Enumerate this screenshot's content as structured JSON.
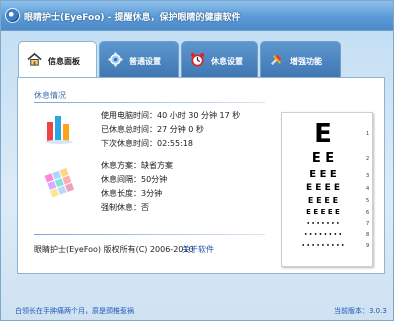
{
  "window": {
    "title": "眼睛护士(EyeFoo) - 提醒休息，保护眼睛的健康软件"
  },
  "tabs": [
    {
      "label": "信息面板",
      "icon": "home-icon",
      "active": true
    },
    {
      "label": "普通设置",
      "icon": "settings-gear-icon",
      "active": false
    },
    {
      "label": "休息设置",
      "icon": "alarm-clock-icon",
      "active": false
    },
    {
      "label": "增强功能",
      "icon": "tools-icon",
      "active": false
    }
  ],
  "info": {
    "section_title": "休息情况",
    "usage_icon": "bar-chart-icon",
    "usage": [
      {
        "label": "使用电脑时间：",
        "value": "40 小时 30 分钟 17 秒"
      },
      {
        "label": "已休息总时间：",
        "value": "27 分钟 0 秒"
      },
      {
        "label": "下次休息时间：",
        "value": "02:55:18"
      }
    ],
    "plan_icon": "color-palette-icon",
    "plan": [
      {
        "label": "休息方案：",
        "value": "缺省方案"
      },
      {
        "label": "休息间隔：",
        "value": "50分钟"
      },
      {
        "label": "休息长度：",
        "value": "3分钟"
      },
      {
        "label": "强制休息：",
        "value": "否"
      }
    ],
    "copyright": "眼睛护士(EyeFoo) 版权所有(C) 2006-2010",
    "about_link": "关于软件"
  },
  "eye_chart": {
    "rows": [
      {
        "letters": "E",
        "number": "1"
      },
      {
        "letters": "E E",
        "number": "2"
      },
      {
        "letters": "E E E",
        "number": "3"
      },
      {
        "letters": "E E E E",
        "number": "4"
      },
      {
        "letters": "E E E E",
        "number": "5"
      },
      {
        "letters": "E E E E E",
        "number": "6"
      },
      {
        "letters": "• • • • • • •",
        "number": "7"
      },
      {
        "letters": "• • • • • • • •",
        "number": "8"
      },
      {
        "letters": "• • • • • • • • •",
        "number": "9"
      }
    ]
  },
  "status": {
    "tip": "白领长在手肿痛两个月，原是颈椎惹祸",
    "version": "当前版本：3.0.3"
  },
  "colors": {
    "title_bar": "#5b9ad6",
    "tab_inactive": "#4a84c0",
    "link": "#1f56b5",
    "section_title": "#3a6fae"
  }
}
